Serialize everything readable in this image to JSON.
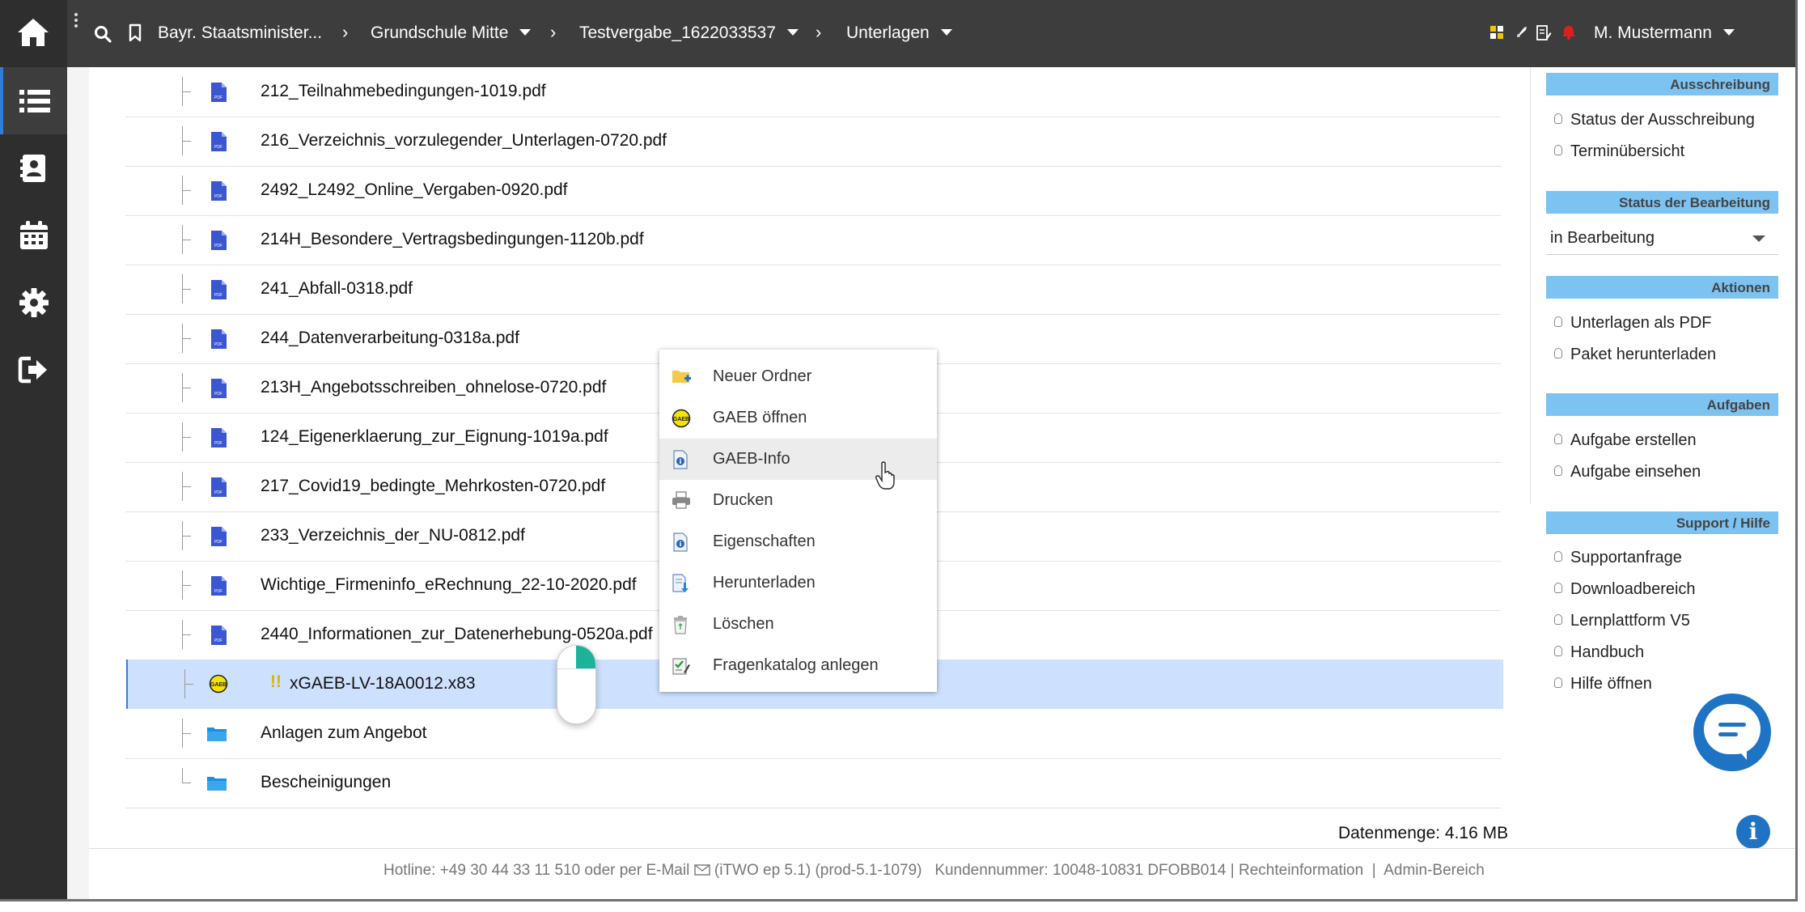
{
  "topbar": {
    "breadcrumbs": [
      "Bayr. Staatsminister...",
      "Grundschule Mitte",
      "Testvergabe_1622033537",
      "Unterlagen"
    ],
    "user": "M. Mustermann"
  },
  "files": [
    {
      "name": "212_Teilnahmebedingungen-1019.pdf",
      "type": "pdf"
    },
    {
      "name": "216_Verzeichnis_vorzulegender_Unterlagen-0720.pdf",
      "type": "pdf"
    },
    {
      "name": "2492_L2492_Online_Vergaben-0920.pdf",
      "type": "pdf"
    },
    {
      "name": "214H_Besondere_Vertragsbedingungen-1120b.pdf",
      "type": "pdf"
    },
    {
      "name": "241_Abfall-0318.pdf",
      "type": "pdf"
    },
    {
      "name": "244_Datenverarbeitung-0318a.pdf",
      "type": "pdf"
    },
    {
      "name": "213H_Angebotsschreiben_ohnelose-0720.pdf",
      "type": "pdf"
    },
    {
      "name": "124_Eigenerklaerung_zur_Eignung-1019a.pdf",
      "type": "pdf"
    },
    {
      "name": "217_Covid19_bedingte_Mehrkosten-0720.pdf",
      "type": "pdf"
    },
    {
      "name": "233_Verzeichnis_der_NU-0812.pdf",
      "type": "pdf"
    },
    {
      "name": "Wichtige_Firmeninfo_eRechnung_22-10-2020.pdf",
      "type": "pdf"
    },
    {
      "name": "2440_Informationen_zur_Datenerhebung-0520a.pdf",
      "type": "pdf"
    },
    {
      "name": "xGAEB-LV-18A0012.x83",
      "type": "gaeb",
      "warning": "!!"
    },
    {
      "name": "Anlagen zum Angebot",
      "type": "folder"
    },
    {
      "name": "Bescheinigungen",
      "type": "folder"
    }
  ],
  "context_menu": [
    {
      "label": "Neuer Ordner",
      "icon": "new-folder-icon"
    },
    {
      "label": "GAEB öffnen",
      "icon": "gaeb-icon"
    },
    {
      "label": "GAEB-Info",
      "icon": "info-document-icon"
    },
    {
      "label": "Drucken",
      "icon": "printer-icon"
    },
    {
      "label": "Eigenschaften",
      "icon": "properties-icon"
    },
    {
      "label": "Herunterladen",
      "icon": "download-icon"
    },
    {
      "label": "Löschen",
      "icon": "trash-icon"
    },
    {
      "label": "Fragenkatalog anlegen",
      "icon": "checklist-icon"
    }
  ],
  "right_panel": {
    "ausschreibung": {
      "title": "Ausschreibung",
      "links": [
        "Status der Ausschreibung",
        "Terminübersicht"
      ]
    },
    "status": {
      "title": "Status der Bearbeitung",
      "value": "in Bearbeitung"
    },
    "aktionen": {
      "title": "Aktionen",
      "links": [
        "Unterlagen als PDF",
        "Paket herunterladen"
      ]
    },
    "aufgaben": {
      "title": "Aufgaben",
      "links": [
        "Aufgabe erstellen",
        "Aufgabe einsehen"
      ]
    },
    "support": {
      "title": "Support / Hilfe",
      "links": [
        "Supportanfrage",
        "Downloadbereich",
        "Lernplattform V5",
        "Handbuch",
        "Hilfe öffnen"
      ]
    }
  },
  "datamenge": "Datenmenge: 4.16 MB",
  "footer": {
    "hotline": "Hotline: +49 30 44 33 11 510 oder per E-Mail",
    "version": "(iTWO ep 5.1) (prod-5.1-1079)",
    "customer": "Kundennummer: 10048-10831 DFOBB014",
    "legal": "Rechteinformation",
    "admin": "Admin-Bereich"
  },
  "colors": {
    "topbar": "#3d3d3d",
    "sidebar": "#2e2e2e",
    "panel_header": "#7cc3f2",
    "selection": "#cde0fd",
    "accent": "#1e73c4"
  }
}
